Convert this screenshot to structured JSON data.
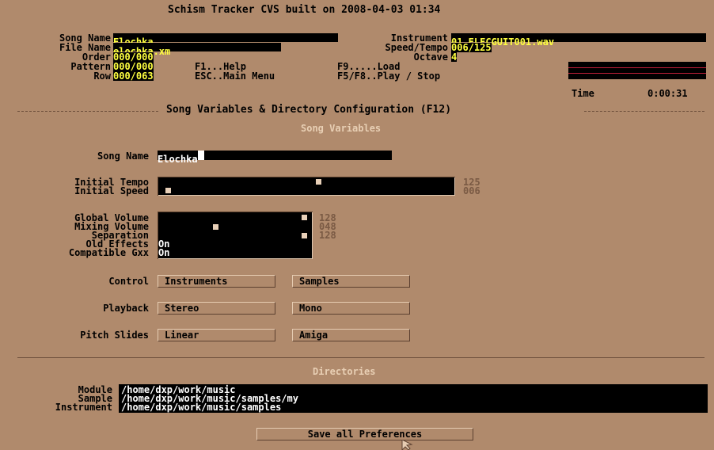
{
  "title": "Schism Tracker CVS built on 2008-04-03 01:34",
  "header": {
    "song_name_label": "Song Name",
    "song_name": "Elochka",
    "file_name_label": "File Name",
    "file_name": "elochka.xm",
    "order_label": "Order",
    "order": "000/000",
    "pattern_label": "Pattern",
    "pattern": "000/000",
    "row_label": "Row",
    "row": "000/063",
    "help_key": "F1...Help",
    "main_menu_key": "ESC..Main Menu",
    "load_key": "F9.....Load",
    "play_key": "F5/F8..Play / Stop",
    "instrument_label": "Instrument",
    "instrument": "01 ELECGUIT001.wav",
    "speed_tempo_label": "Speed/Tempo",
    "speed_tempo": "006/125",
    "octave_label": "Octave",
    "octave": "4",
    "time_label": "Time",
    "time": "0:00:31"
  },
  "section_title": "Song Variables & Directory Configuration (F12)",
  "song_variables": {
    "heading": "Song Variables",
    "song_name_label": "Song Name",
    "song_name": "Elochka",
    "initial_tempo_label": "Initial Tempo",
    "initial_tempo": "125",
    "initial_tempo_level": 0.55,
    "initial_speed_label": "Initial Speed",
    "initial_speed": "006",
    "initial_speed_level": 0.02,
    "global_volume_label": "Global Volume",
    "global_volume": "128",
    "global_volume_level": 1.0,
    "mixing_volume_label": "Mixing Volume",
    "mixing_volume": "048",
    "mixing_volume_level": 0.375,
    "separation_label": "Separation",
    "separation": "128",
    "separation_level": 1.0,
    "old_effects_label": "Old Effects",
    "old_effects": "On",
    "compatible_gxx_label": "Compatible Gxx",
    "compatible_gxx": "On",
    "control_label": "Control",
    "control_options": [
      "Instruments",
      "Samples"
    ],
    "playback_label": "Playback",
    "playback_options": [
      "Stereo",
      "Mono"
    ],
    "pitch_slides_label": "Pitch Slides",
    "pitch_slides_options": [
      "Linear",
      "Amiga"
    ]
  },
  "directories": {
    "heading": "Directories",
    "module_label": "Module",
    "module": "/home/dxp/work/music",
    "sample_label": "Sample",
    "sample": "/home/dxp/work/music/samples/my",
    "instrument_label": "Instrument",
    "instrument": "/home/dxp/work/music/samples"
  },
  "save_button": "Save all Preferences",
  "colors": {
    "background": "#b08a6c",
    "field_text": "#ffff40",
    "field_bg": "#000000",
    "dim_value": "#7a5a44",
    "vu_line": "#c0203a"
  }
}
